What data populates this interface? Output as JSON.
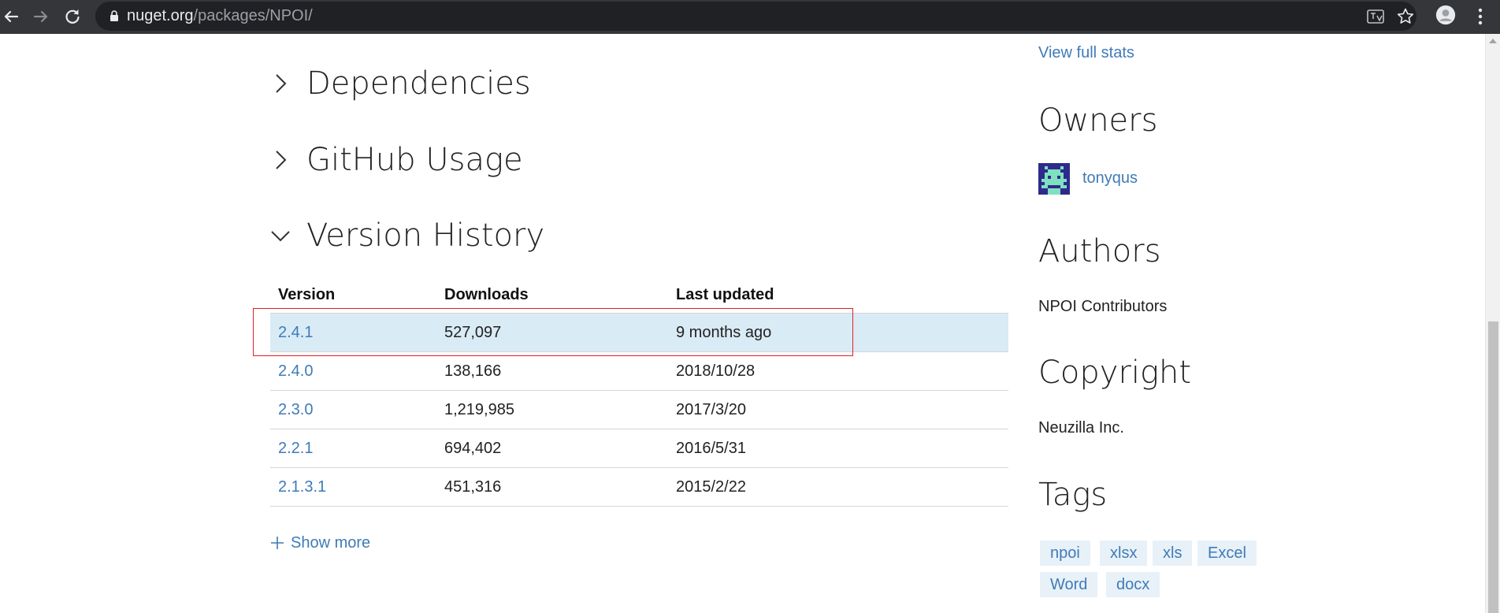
{
  "browser": {
    "url_host": "nuget.org",
    "url_path": "/packages/NPOI/"
  },
  "sections": {
    "dependencies": "Dependencies",
    "github_usage": "GitHub Usage",
    "version_history": "Version History"
  },
  "version_history": {
    "columns": [
      "Version",
      "Downloads",
      "Last updated"
    ],
    "rows": [
      {
        "version": "2.4.1",
        "downloads": "527,097",
        "last_updated": "9 months ago",
        "current": true
      },
      {
        "version": "2.4.0",
        "downloads": "138,166",
        "last_updated": "2018/10/28",
        "current": false
      },
      {
        "version": "2.3.0",
        "downloads": "1,219,985",
        "last_updated": "2017/3/20",
        "current": false
      },
      {
        "version": "2.2.1",
        "downloads": "694,402",
        "last_updated": "2016/5/31",
        "current": false
      },
      {
        "version": "2.1.3.1",
        "downloads": "451,316",
        "last_updated": "2015/2/22",
        "current": false
      }
    ],
    "show_more": "Show more"
  },
  "sidebar": {
    "view_full_stats": "View full stats",
    "owners_heading": "Owners",
    "owner_name": "tonyqus",
    "authors_heading": "Authors",
    "authors": "NPOI Contributors",
    "copyright_heading": "Copyright",
    "copyright": "Neuzilla Inc.",
    "tags_heading": "Tags",
    "tags": [
      "npoi",
      "xlsx",
      "xls",
      "Excel",
      "Word",
      "docx"
    ]
  },
  "colors": {
    "link": "#3e7bb8",
    "current_row_bg": "#d9ebf5",
    "highlight_box": "#e02020",
    "tag_bg": "#e8f1f8"
  }
}
